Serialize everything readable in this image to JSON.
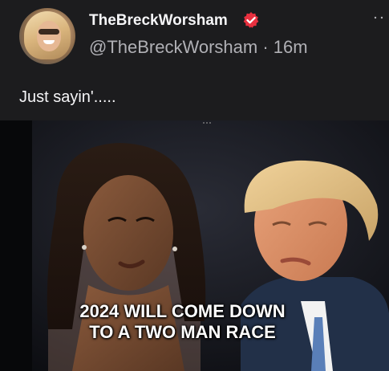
{
  "post": {
    "display_name": "TheBreckWorsham",
    "handle": "@TheBreckWorsham",
    "separator": "·",
    "time": "16m",
    "text": "Just sayin'.....",
    "verified_icon": "verified-badge-icon",
    "more_icon": "more-options-icon"
  },
  "media": {
    "caption_line_1": "2024 WILL COME DOWN",
    "caption_line_2": "TO A TWO MAN RACE"
  },
  "colors": {
    "background": "#1c1c1e",
    "verified": "#e8303f",
    "text_primary": "#f5f5f7",
    "text_secondary": "#b0b0b5"
  }
}
